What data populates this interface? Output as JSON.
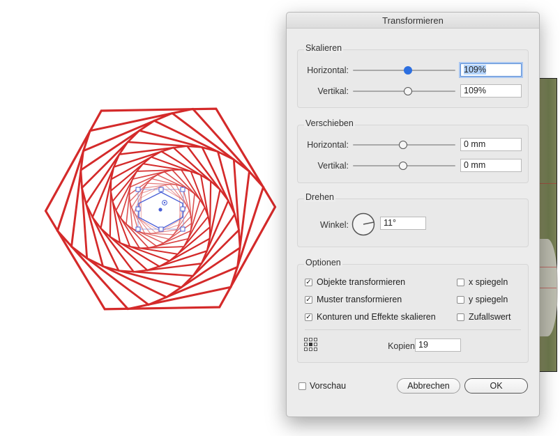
{
  "dialog": {
    "title": "Transformieren"
  },
  "scale": {
    "legend": "Skalieren",
    "horizontal_label": "Horizontal:",
    "horizontal_value": "109%",
    "vertical_label": "Vertikal:",
    "vertical_value": "109%"
  },
  "move": {
    "legend": "Verschieben",
    "horizontal_label": "Horizontal:",
    "horizontal_value": "0 mm",
    "vertical_label": "Vertikal:",
    "vertical_value": "0 mm"
  },
  "rotate": {
    "legend": "Drehen",
    "angle_label": "Winkel:",
    "angle_value": "11°"
  },
  "options": {
    "legend": "Optionen",
    "transform_objects": {
      "label": "Objekte transformieren",
      "checked": true
    },
    "transform_patterns": {
      "label": "Muster transformieren",
      "checked": true
    },
    "scale_strokes": {
      "label": "Konturen und Effekte skalieren",
      "checked": true
    },
    "reflect_x": {
      "label": "x spiegeln",
      "checked": false
    },
    "reflect_y": {
      "label": "y spiegeln",
      "checked": false
    },
    "random": {
      "label": "Zufallswert",
      "checked": false
    },
    "copies_label": "Kopien",
    "copies_value": "19"
  },
  "footer": {
    "preview": {
      "label": "Vorschau",
      "checked": false
    },
    "cancel_label": "Abbrechen",
    "ok_label": "OK"
  },
  "colors": {
    "artwork_stroke": "#d42a2a",
    "selection": "#4a5fd6",
    "accent": "#2d6fe0"
  }
}
